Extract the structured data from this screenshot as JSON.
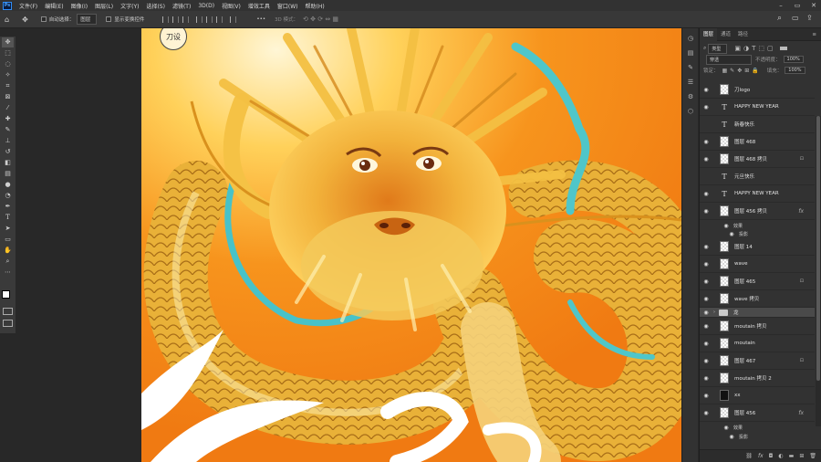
{
  "menubar": {
    "items": [
      "文件(F)",
      "编辑(E)",
      "图像(I)",
      "图层(L)",
      "文字(Y)",
      "选择(S)",
      "滤镜(T)",
      "3D(D)",
      "视图(V)",
      "增效工具",
      "窗口(W)",
      "帮助(H)"
    ]
  },
  "options": {
    "auto_select": "自动选择：",
    "layer_dropdown": "图层",
    "show_transform": "显示变换控件",
    "mode_3d": "3D 模式："
  },
  "canvas": {
    "logo_text": "刀设"
  },
  "layers_panel": {
    "tabs": [
      "图层",
      "通道",
      "路径"
    ],
    "filter_kind": "类型",
    "blend_mode": "穿透",
    "opacity_label": "不透明度：",
    "opacity_value": "100%",
    "lock_label": "锁定：",
    "fill_label": "填充：",
    "fill_value": "100%",
    "layers": [
      {
        "name": "刀logo",
        "kind": "pixel"
      },
      {
        "name": "HAPPY NEW YEAR",
        "kind": "text"
      },
      {
        "name": "新春快乐",
        "kind": "text"
      },
      {
        "name": "图层 468",
        "kind": "pixel"
      },
      {
        "name": "图层 468 拷贝",
        "kind": "pixel",
        "locked": true
      },
      {
        "name": "元旦快乐",
        "kind": "text"
      },
      {
        "name": "HAPPY NEW YEAR",
        "kind": "text"
      },
      {
        "name": "图层 456 拷贝",
        "kind": "pixel",
        "fx": true
      },
      {
        "name": "图层 14",
        "kind": "pixel"
      },
      {
        "name": "wave",
        "kind": "pixel"
      },
      {
        "name": "图层 465",
        "kind": "pixel",
        "locked": true
      },
      {
        "name": "wave 拷贝",
        "kind": "pixel"
      },
      {
        "name": "龙",
        "kind": "group",
        "selected": true
      },
      {
        "name": "moutain 拷贝",
        "kind": "pixel"
      },
      {
        "name": "moutain",
        "kind": "pixel"
      },
      {
        "name": "图层 467",
        "kind": "pixel",
        "locked": true
      },
      {
        "name": "moutain 拷贝 2",
        "kind": "pixel"
      },
      {
        "name": "xx",
        "kind": "pixel-dark"
      },
      {
        "name": "图层 456",
        "kind": "pixel",
        "fx": true
      }
    ],
    "effects_label": "效果",
    "shadow_label": "投影"
  },
  "tools": [
    "move-tool",
    "marquee-tool",
    "lasso-tool",
    "magic-wand-tool",
    "crop-tool",
    "frame-tool",
    "eyedropper-tool",
    "healing-brush-tool",
    "brush-tool",
    "clone-stamp-tool",
    "history-brush-tool",
    "eraser-tool",
    "gradient-tool",
    "blur-tool",
    "dodge-tool",
    "pen-tool",
    "type-tool",
    "path-select-tool",
    "rectangle-tool",
    "hand-tool",
    "zoom-tool",
    "more-tools"
  ],
  "colors": {
    "foreground": "#ffffff",
    "background": "#e0301e",
    "canvas_orange": "#f58a1c"
  }
}
